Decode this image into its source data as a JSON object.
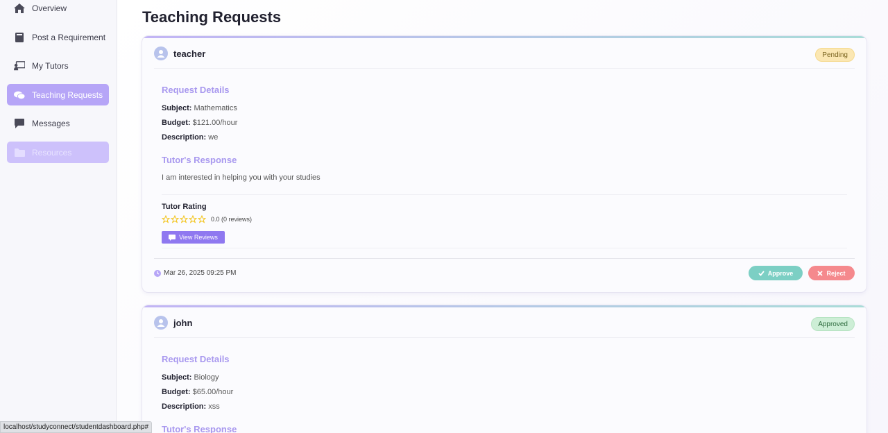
{
  "sidebar": {
    "items": [
      {
        "label": "Overview",
        "icon": "home-icon"
      },
      {
        "label": "Post a Requirement",
        "icon": "book-icon"
      },
      {
        "label": "My Tutors",
        "icon": "chalkboard-teacher-icon"
      },
      {
        "label": "Teaching Requests",
        "icon": "comments-icon",
        "active": true
      },
      {
        "label": "Messages",
        "icon": "message-icon"
      },
      {
        "label": "Resources",
        "icon": "folder-icon"
      }
    ]
  },
  "main": {
    "title": "Teaching Requests",
    "requests": [
      {
        "username": "teacher",
        "status": "Pending",
        "details_heading": "Request Details",
        "subject_label": "Subject:",
        "subject": "Mathematics",
        "budget_label": "Budget:",
        "budget": "$121.00/hour",
        "description_label": "Description:",
        "description": "we",
        "response_heading": "Tutor's Response",
        "response": "I am interested in helping you with your studies",
        "rating_heading": "Tutor Rating",
        "rating_value": 0,
        "rating_text": "0.0 (0 reviews)",
        "view_reviews_label": "View Reviews",
        "timestamp": "Mar 26, 2025 09:25 PM",
        "approve_label": "Approve",
        "reject_label": "Reject"
      },
      {
        "username": "john",
        "status": "Approved",
        "details_heading": "Request Details",
        "subject_label": "Subject:",
        "subject": "Biology",
        "budget_label": "Budget:",
        "budget": "$65.00/hour",
        "description_label": "Description:",
        "description": "xss",
        "response_heading": "Tutor's Response"
      }
    ]
  },
  "status_bar": {
    "url": "localhost/studyconnect/studentdashboard.php#"
  },
  "colors": {
    "accent": "#b6a5f7",
    "section_title": "#a898ef",
    "approve": "#7ccfc4",
    "reject": "#f5898d",
    "pending_badge": "#fbe7b3",
    "approved_badge": "#cdeed6"
  }
}
